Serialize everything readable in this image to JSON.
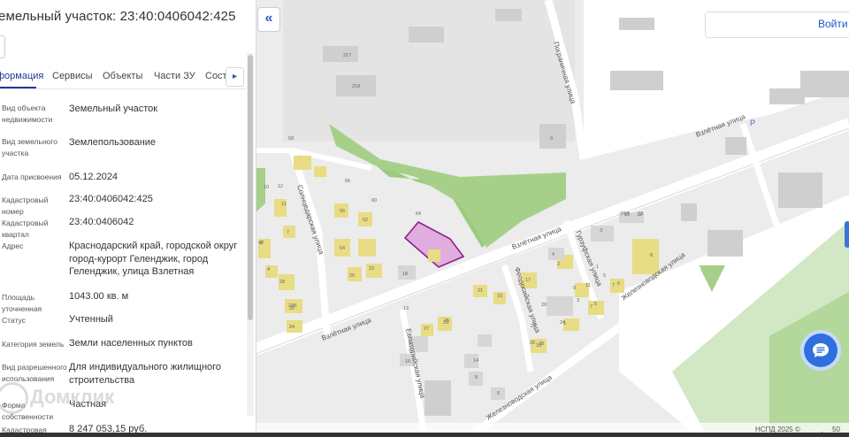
{
  "panel": {
    "title": "емельный участок: 23:40:0406042:425",
    "tabs": [
      "формация",
      "Сервисы",
      "Объекты",
      "Части ЗУ",
      "Состав"
    ],
    "rows": [
      {
        "label": "Вид объекта недвижимости",
        "value": "Земельный участок"
      },
      {
        "label": "Вид земельного участка",
        "value": "Землепользование"
      },
      {
        "label": "Дата присвоения",
        "value": "05.12.2024"
      },
      {
        "label": "Кадастровый номер",
        "value": "23:40:0406042:425"
      },
      {
        "label": "Кадастровый квартал",
        "value": "23:40:0406042"
      },
      {
        "label": "Адрес",
        "value": "Краснодарский край, городской округ город-курорт Геленджик, город Геленджик, улица Взлетная"
      },
      {
        "label": "Площадь уточненная",
        "value": "1043.00 кв. м"
      },
      {
        "label": "Статус",
        "value": "Учтенный"
      },
      {
        "label": "Категория земель",
        "value": "Земли населенных пунктов"
      },
      {
        "label": "Вид разрешенного использования",
        "value": "Для индивидуального жилищного строительства"
      },
      {
        "label": "Форма собственности",
        "value": "Частная"
      },
      {
        "label": "Кадастровая",
        "value": "8 247 053,15 руб."
      }
    ],
    "watermark": "Домклик"
  },
  "map": {
    "login_label": "Войти",
    "collapse_icon": "«",
    "scale_credit": "НСПД 2025 ©",
    "scale_value": "50",
    "streets": {
      "vzletnaya_1": "Взлётная улица",
      "vzletnaya_2": "Взлётная улица",
      "vzletnaya_3": "Взлётная улица",
      "solnechnaya": "Солнцедарская улица",
      "pogranichnaya": "Пограничная улица",
      "gurzufskaya": "Гурзуфская улица",
      "feodosiyskaya": "Феодосийская улица",
      "zheleznovodskaya_1": "Железноводская улица",
      "zheleznovodskaya_2": "Железноводская улица",
      "evpatoriyskaya": "Евпаторийская улица"
    },
    "building_numbers": [
      "217",
      "218",
      "9",
      "10",
      "12",
      "58",
      "11",
      "2",
      "7",
      "66",
      "60",
      "56",
      "62",
      "64",
      "54",
      "42",
      "4",
      "28",
      "26",
      "24",
      "24Б",
      "18",
      "20",
      "22",
      "13",
      "21",
      "23",
      "27",
      "25",
      "17",
      "15",
      "19",
      "16",
      "14",
      "8",
      "6",
      "4",
      "2",
      "11",
      "9",
      "7",
      "5",
      "3",
      "1",
      "13",
      "12",
      "8",
      "7",
      "6",
      "21А",
      "11",
      "1",
      "5",
      "3",
      "28",
      "26",
      "24",
      "20",
      "22",
      "P"
    ],
    "colors": {
      "parcel_fill": "#d98ed8",
      "parcel_stroke": "#8e1f8c",
      "green": "#9ccb7d",
      "road": "#ffffff",
      "building": "#cfcfcf",
      "building_highlight": "#e8dc84",
      "accent": "#2f6fe0"
    }
  }
}
